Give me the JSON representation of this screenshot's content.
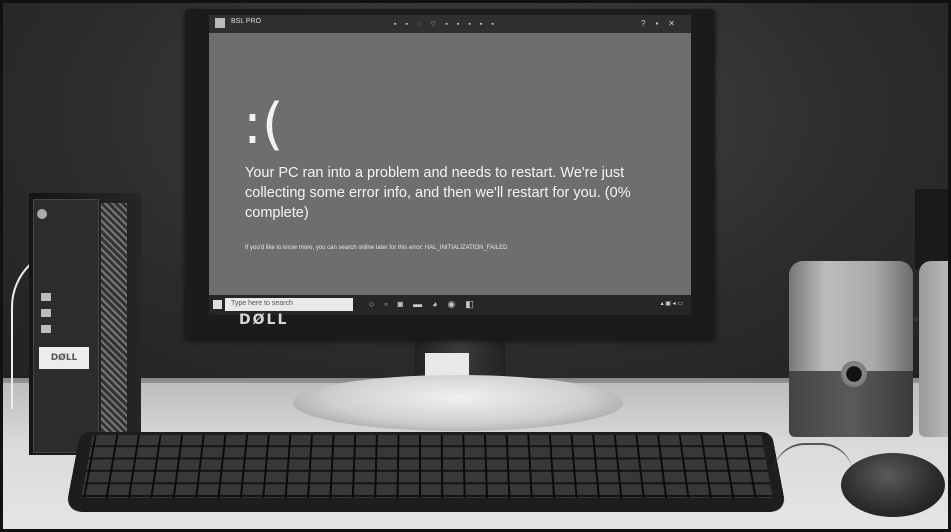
{
  "screen": {
    "title": "BSL PRO",
    "frown": ":(",
    "message": "Your PC ran into a problem and needs to restart. We're just collecting some error info, and then we'll restart for you. (0% complete)",
    "info": "If you'd like to know more, you can search online later for this error: HAL_INITIALIZATION_FAILED"
  },
  "taskbar": {
    "search_placeholder": "Type here to search"
  },
  "monitor": {
    "brand": "DØLL"
  },
  "tower": {
    "brand": "DØLL"
  }
}
